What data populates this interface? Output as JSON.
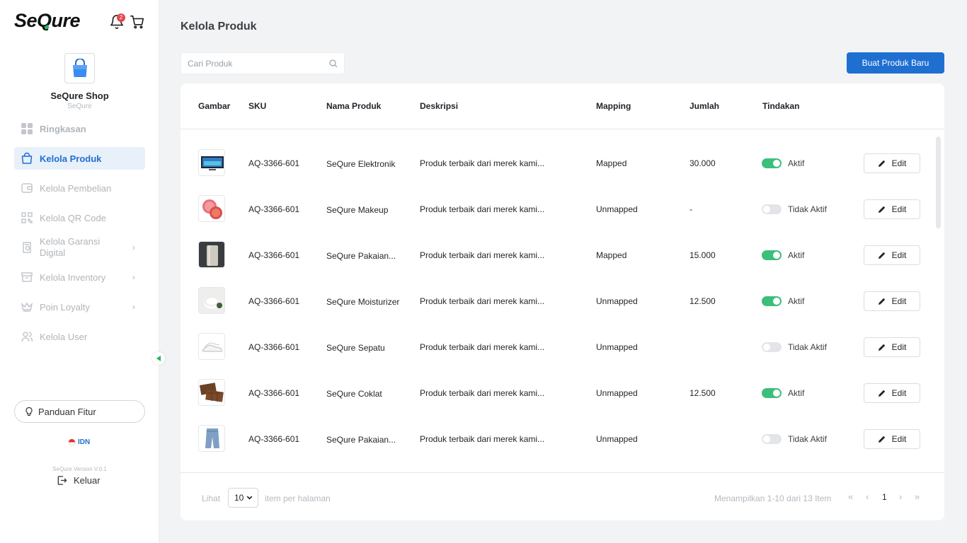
{
  "app": {
    "logo": "SeQure",
    "notification_count": "2"
  },
  "shop": {
    "name": "SeQure Shop",
    "subtitle": "SeQure"
  },
  "sidebar": {
    "items": [
      {
        "label": "Ringkasan",
        "icon": "dashboard-grid-icon"
      },
      {
        "label": "Kelola Produk",
        "icon": "shopping-bag-icon"
      },
      {
        "label": "Kelola Pembelian",
        "icon": "wallet-icon"
      },
      {
        "label": "Kelola QR Code",
        "icon": "qr-code-icon"
      },
      {
        "label": "Kelola Garansi Digital",
        "icon": "warranty-document-icon"
      },
      {
        "label": "Kelola Inventory",
        "icon": "inventory-box-icon"
      },
      {
        "label": "Poin Loyalty",
        "icon": "crown-basket-icon"
      },
      {
        "label": "Kelola User",
        "icon": "users-icon"
      }
    ],
    "guide_label": "Panduan Fitur",
    "language": "IDN",
    "version": "SeQure Version V.0.1",
    "logout_label": "Keluar"
  },
  "page": {
    "title": "Kelola Produk",
    "search_placeholder": "Cari Produk",
    "new_button": "Buat Produk Baru"
  },
  "table": {
    "headers": {
      "image": "Gambar",
      "sku": "SKU",
      "name": "Nama Produk",
      "description": "Deskripsi",
      "mapping": "Mapping",
      "quantity": "Jumlah",
      "action": "Tindakan"
    },
    "edit_label": "Edit",
    "rows": [
      {
        "sku": "AQ-3366-601",
        "name": "SeQure Elektronik",
        "description": "Produk terbaik dari merek kami...",
        "mapping": "Mapped",
        "quantity": "30.000",
        "status": "Aktif",
        "active": true,
        "image": "tv"
      },
      {
        "sku": "AQ-3366-601",
        "name": "SeQure Makeup",
        "description": "Produk terbaik dari merek kami...",
        "mapping": "Unmapped",
        "quantity": "-",
        "status": "Tidak Aktif",
        "active": false,
        "image": "makeup"
      },
      {
        "sku": "AQ-3366-601",
        "name": "SeQure Pakaian...",
        "description": "Produk terbaik dari merek kami...",
        "mapping": "Mapped",
        "quantity": "15.000",
        "status": "Aktif",
        "active": true,
        "image": "clothing"
      },
      {
        "sku": "AQ-3366-601",
        "name": "SeQure Moisturizer",
        "description": "Produk terbaik dari merek kami...",
        "mapping": "Unmapped",
        "quantity": "12.500",
        "status": "Aktif",
        "active": true,
        "image": "cream"
      },
      {
        "sku": "AQ-3366-601",
        "name": "SeQure Sepatu",
        "description": "Produk terbaik dari merek kami...",
        "mapping": "Unmapped",
        "quantity": "",
        "status": "Tidak Aktif",
        "active": false,
        "image": "shoes"
      },
      {
        "sku": "AQ-3366-601",
        "name": "SeQure Coklat",
        "description": "Produk terbaik dari merek kami...",
        "mapping": "Unmapped",
        "quantity": "12.500",
        "status": "Aktif",
        "active": true,
        "image": "chocolate"
      },
      {
        "sku": "AQ-3366-601",
        "name": "SeQure Pakaian...",
        "description": "Produk terbaik dari merek kami...",
        "mapping": "Unmapped",
        "quantity": "",
        "status": "Tidak Aktif",
        "active": false,
        "image": "jeans"
      }
    ]
  },
  "pagination": {
    "show_label": "Lihat",
    "per_page": "10",
    "per_page_label": "item per halaman",
    "summary": "Menampilkan 1-10 dari 13 Item",
    "current_page": "1"
  },
  "colors": {
    "primary": "#1f6fd1",
    "toggle_on": "#3bbf7a",
    "toggle_off": "#e3e5e8",
    "badge": "#e5484d"
  }
}
